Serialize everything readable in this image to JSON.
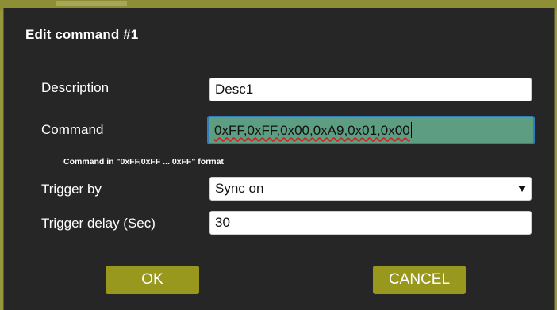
{
  "colors": {
    "accent": "#98981f",
    "dialog_background": "#262626",
    "page_background": "#96963c",
    "focused_input_background": "#5d9e82",
    "focus_border": "#2f7dbd"
  },
  "dialog": {
    "title": "Edit command #1"
  },
  "form": {
    "description": {
      "label": "Description",
      "value": "Desc1"
    },
    "command": {
      "label": "Command",
      "value": "0xFF,0xFF,0x00,0xA9,0x01,0x00",
      "hint": "Command in \"0xFF,0xFF ... 0xFF\" format"
    },
    "trigger_by": {
      "label": "Trigger by",
      "selected": "Sync on",
      "icon": "chevron-down-icon"
    },
    "trigger_delay": {
      "label": "Trigger delay (Sec)",
      "value": "30"
    }
  },
  "buttons": {
    "ok": "OK",
    "cancel": "CANCEL"
  }
}
